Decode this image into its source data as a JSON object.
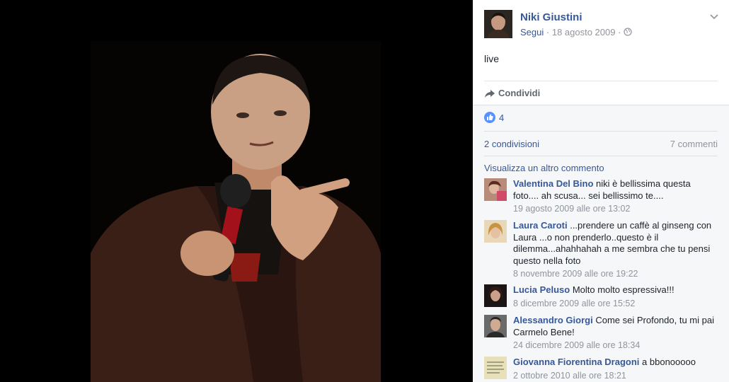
{
  "post": {
    "author": "Niki Giustini",
    "follow_label": "Segui",
    "separator": "·",
    "date": "18 agosto 2009",
    "privacy_icon": "globe-icon",
    "text": "live",
    "share_label": "Condividi",
    "like_count": "4",
    "shares_label": "2 condivisioni",
    "comments_label": "7 commenti",
    "more_comments_label": "Visualizza un altro commento"
  },
  "comments": [
    {
      "name": "Valentina Del Bino",
      "text": "niki è bellissima questa foto.... ah scusa... sei bellissimo te....",
      "time": "19 agosto 2009 alle ore 13:02"
    },
    {
      "name": "Laura Caroti",
      "text": "...prendere un caffè al ginseng con Laura ...o non prenderlo..questo è il dilemma...ahahhahah a me sembra che tu pensi questo nella foto",
      "time": "8 novembre 2009 alle ore 19:22"
    },
    {
      "name": "Lucia Peluso",
      "text": "Molto molto espressiva!!!",
      "time": "8 dicembre 2009 alle ore 15:52"
    },
    {
      "name": "Alessandro Giorgi",
      "text": "Come sei Profondo, tu mi pai Carmelo Bene!",
      "time": "24 dicembre 2009 alle ore 18:34"
    },
    {
      "name": "Giovanna Fiorentina Dragoni",
      "text": "a bbonooooo",
      "time": "2 ottobre 2010 alle ore 18:21"
    }
  ],
  "colors": {
    "link": "#365899",
    "muted": "#90949c",
    "like_blue": "#5890ff",
    "panel_gray": "#f6f7f9"
  }
}
